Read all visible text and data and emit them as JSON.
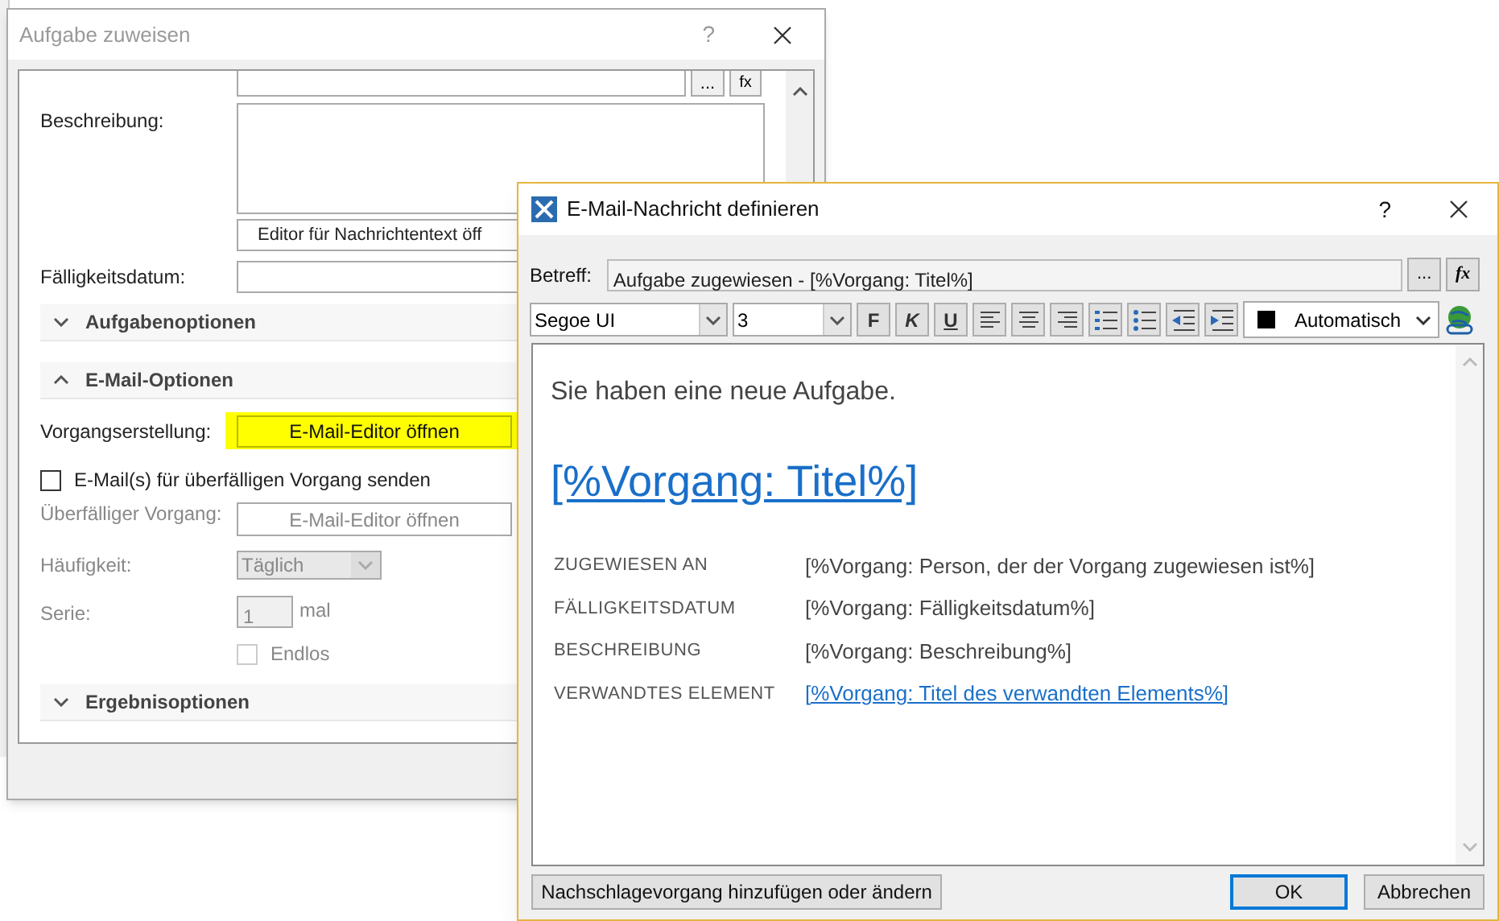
{
  "back_window": {
    "title": "Aufgabe zuweisen",
    "help": "?",
    "task_title": {
      "dots": "...",
      "fx": "fx"
    },
    "description": {
      "label": "Beschreibung:",
      "editor_button": "Editor für Nachrichtentext öff"
    },
    "due_date": {
      "label": "Fälligkeitsdatum:"
    },
    "task_options": {
      "label": "Aufgabenoptionen",
      "expanded": false
    },
    "email_options": {
      "label": "E-Mail-Optionen",
      "expanded": true
    },
    "process_creation": {
      "label": "Vorgangserstellung:",
      "button": "E-Mail-Editor öffnen",
      "highlighted": true
    },
    "overdue_checkbox": {
      "label": "E-Mail(s) für überfälligen Vorgang senden",
      "checked": false
    },
    "overdue_process": {
      "label": "Überfälliger Vorgang:",
      "button": "E-Mail-Editor öffnen",
      "disabled": true
    },
    "frequency": {
      "label": "Häufigkeit:",
      "value": "Täglich",
      "disabled": true
    },
    "series": {
      "label": "Serie:",
      "value": "1",
      "unit": "mal",
      "disabled": true
    },
    "endless": {
      "label": "Endlos",
      "checked": false,
      "disabled": true
    },
    "result_options": {
      "label": "Ergebnisoptionen",
      "expanded": false
    }
  },
  "front_window": {
    "title": "E-Mail-Nachricht definieren",
    "help": "?",
    "subject": {
      "label": "Betreff:",
      "value": "Aufgabe zugewiesen - [%Vorgang: Titel%]",
      "dots": "...",
      "fx": "fx"
    },
    "font": {
      "value": "Segoe UI"
    },
    "size": {
      "value": "3"
    },
    "format_buttons": [
      {
        "label": "F"
      },
      {
        "label": "K"
      },
      {
        "label": "U"
      }
    ],
    "text_color": {
      "label": "Automatisch",
      "color": "#000000"
    },
    "body": {
      "intro": "Sie haben eine neue Aufgabe.",
      "title_link": "[%Vorgang: Titel%]",
      "rows": [
        {
          "label": "ZUGEWIESEN AN",
          "value": "[%Vorgang: Person, der der Vorgang zugewiesen ist%]",
          "kind": "text"
        },
        {
          "label": "FÄLLIGKEITSDATUM",
          "value": "[%Vorgang: Fälligkeitsdatum%]",
          "kind": "text"
        },
        {
          "label": "BESCHREIBUNG",
          "value": "[%Vorgang: Beschreibung%]",
          "kind": "text"
        },
        {
          "label": "VERWANDTES ELEMENT",
          "value": "[%Vorgang: Titel des verwandten Elements%]",
          "kind": "link"
        }
      ]
    },
    "lookup_button": "Nachschlagevorgang hinzufügen oder ändern",
    "ok_button": {
      "label": "OK",
      "default": true
    },
    "cancel_button": "Abbrechen"
  }
}
